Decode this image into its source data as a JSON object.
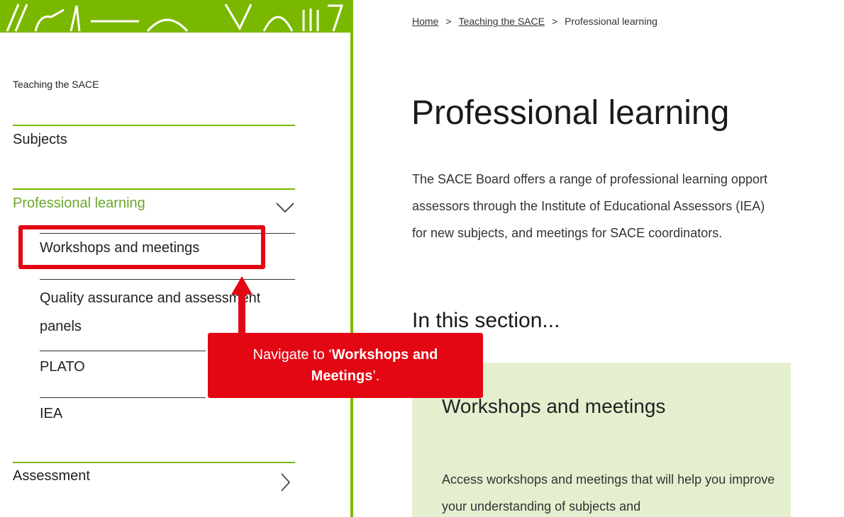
{
  "colors": {
    "brand_green": "#7ab800",
    "active_text": "#6aa72a",
    "card_bg": "#e4efcf",
    "annotation_red": "#e30613"
  },
  "breadcrumb": {
    "home": "Home",
    "teaching": "Teaching the SACE",
    "current": "Professional learning",
    "separator": ">"
  },
  "sidebar": {
    "heading": "Teaching the SACE",
    "items": [
      {
        "label": "Subjects"
      },
      {
        "label": "Professional learning",
        "icon": "chevron-down-icon",
        "active": true
      },
      {
        "label": "Assessment",
        "icon": "chevron-right-icon"
      }
    ],
    "subitems": [
      {
        "label": "Workshops and meetings"
      },
      {
        "label": "Quality assurance and assessment panels"
      },
      {
        "label": "PLATO"
      },
      {
        "label": "IEA"
      }
    ]
  },
  "main": {
    "title": "Professional learning",
    "intro_lines": [
      "The SACE Board offers a range of professional learning opport",
      "assessors through the Institute of Educational Assessors (IEA)",
      "for new subjects, and meetings for SACE coordinators."
    ],
    "section_heading": "In this section...",
    "card": {
      "title": "Workshops and meetings",
      "text": "Access workshops and meetings that will help you improve your understanding of subjects and"
    }
  },
  "annotation": {
    "prefix": "Navigate to ‘",
    "bold": "Workshops and Meetings",
    "suffix": "’."
  }
}
